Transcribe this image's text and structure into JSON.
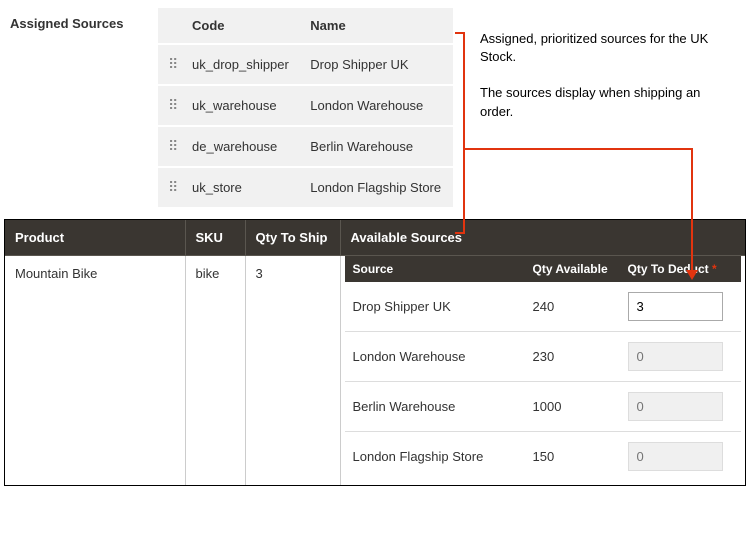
{
  "assigned_sources": {
    "label": "Assigned Sources",
    "headers": {
      "code": "Code",
      "name": "Name"
    },
    "rows": [
      {
        "code": "uk_drop_shipper",
        "name": "Drop Shipper UK"
      },
      {
        "code": "uk_warehouse",
        "name": "London Warehouse"
      },
      {
        "code": "de_warehouse",
        "name": "Berlin Warehouse"
      },
      {
        "code": "uk_store",
        "name": "London Flagship Store"
      }
    ]
  },
  "annotations": {
    "a1": "Assigned, prioritized sources for the UK Stock.",
    "a2": "The sources display when shipping an order."
  },
  "shipment": {
    "headers": {
      "product": "Product",
      "sku": "SKU",
      "qty": "Qty To Ship",
      "available": "Available Sources"
    },
    "product": "Mountain Bike",
    "sku": "bike",
    "qty": "3",
    "inner_headers": {
      "source": "Source",
      "avail": "Qty Available",
      "deduct": "Qty To Deduct",
      "asterisk": "*"
    },
    "sources": [
      {
        "name": "Drop Shipper UK",
        "avail": "240",
        "deduct": "3",
        "enabled": true
      },
      {
        "name": "London Warehouse",
        "avail": "230",
        "deduct": "0",
        "enabled": false
      },
      {
        "name": "Berlin Warehouse",
        "avail": "1000",
        "deduct": "0",
        "enabled": false
      },
      {
        "name": "London Flagship Store",
        "avail": "150",
        "deduct": "0",
        "enabled": false
      }
    ]
  }
}
